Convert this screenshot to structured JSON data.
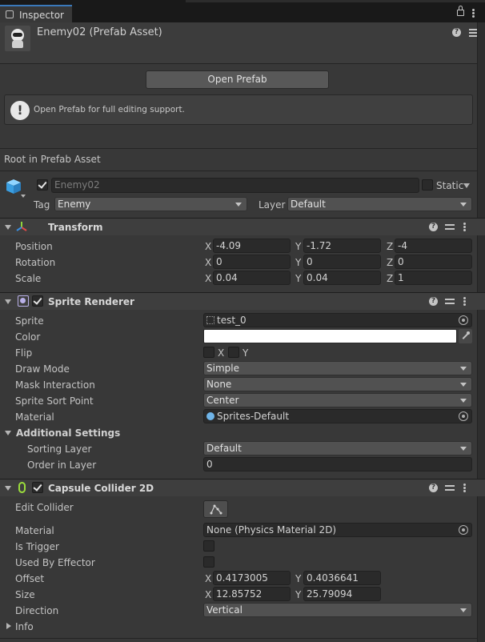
{
  "window": {
    "tab_label": "Inspector"
  },
  "asset": {
    "title": "Enemy02 (Prefab Asset)",
    "open_button": "Open Prefab",
    "info_message": "Open Prefab for full editing support.",
    "root_label": "Root in Prefab Asset"
  },
  "gameobject": {
    "name": "Enemy02",
    "static_label": "Static",
    "tag_label": "Tag",
    "tag_value": "Enemy",
    "layer_label": "Layer",
    "layer_value": "Default"
  },
  "transform": {
    "title": "Transform",
    "rows": [
      {
        "label": "Position",
        "x": "-4.09",
        "y": "-1.72",
        "z": "-4"
      },
      {
        "label": "Rotation",
        "x": "0",
        "y": "0",
        "z": "0"
      },
      {
        "label": "Scale",
        "x": "0.04",
        "y": "0.04",
        "z": "1"
      }
    ],
    "axis_x": "X",
    "axis_y": "Y",
    "axis_z": "Z"
  },
  "sprite_renderer": {
    "title": "Sprite Renderer",
    "sprite_label": "Sprite",
    "sprite_value": "test_0",
    "color_label": "Color",
    "color_value": "#ffffff",
    "flip_label": "Flip",
    "flip_x": "X",
    "flip_y": "Y",
    "draw_mode_label": "Draw Mode",
    "draw_mode_value": "Simple",
    "mask_label": "Mask Interaction",
    "mask_value": "None",
    "sort_point_label": "Sprite Sort Point",
    "sort_point_value": "Center",
    "material_label": "Material",
    "material_value": "Sprites-Default",
    "additional_label": "Additional Settings",
    "sorting_layer_label": "Sorting Layer",
    "sorting_layer_value": "Default",
    "order_label": "Order in Layer",
    "order_value": "0"
  },
  "capsule_collider": {
    "title": "Capsule Collider 2D",
    "edit_label": "Edit Collider",
    "material_label": "Material",
    "material_value": "None (Physics Material 2D)",
    "trigger_label": "Is Trigger",
    "effector_label": "Used By Effector",
    "offset_label": "Offset",
    "offset_x": "0.4173005",
    "offset_y": "0.4036641",
    "size_label": "Size",
    "size_x": "12.85752",
    "size_y": "25.79094",
    "direction_label": "Direction",
    "direction_value": "Vertical",
    "info_label": "Info"
  },
  "colors": {
    "panel_bg": "#383838",
    "field_bg": "#2a2a2a",
    "collider_icon": "#9bdc3c"
  }
}
